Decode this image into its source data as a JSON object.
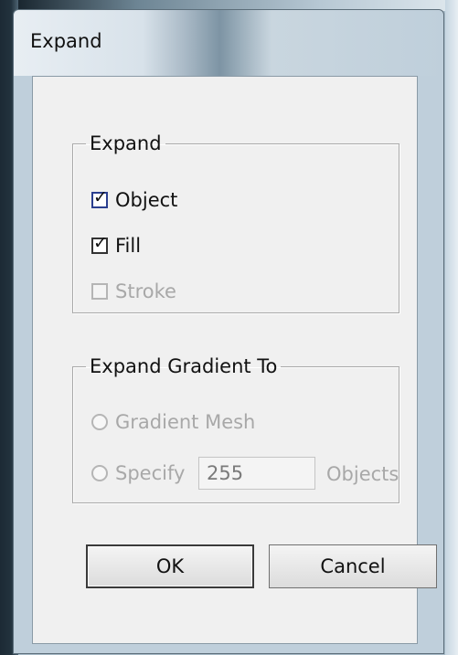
{
  "window": {
    "title": "Expand"
  },
  "expand_group": {
    "legend": "Expand",
    "options": [
      {
        "label": "Object",
        "checked": true,
        "enabled": true
      },
      {
        "label": "Fill",
        "checked": true,
        "enabled": true
      },
      {
        "label": "Stroke",
        "checked": false,
        "enabled": false
      }
    ]
  },
  "gradient_group": {
    "legend": "Expand Gradient To",
    "gradient_mesh_label": "Gradient Mesh",
    "specify_label": "Specify",
    "specify_value": "255",
    "objects_label": "Objects"
  },
  "buttons": {
    "ok": "OK",
    "cancel": "Cancel"
  }
}
